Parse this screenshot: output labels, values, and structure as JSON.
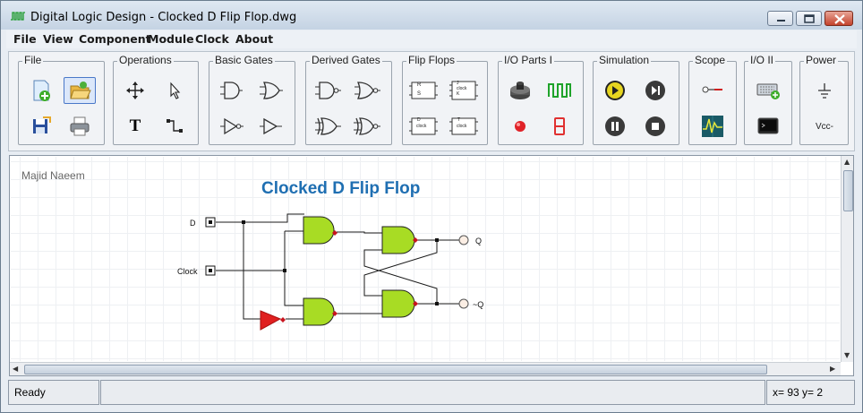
{
  "window": {
    "title": "Digital Logic Design - Clocked D Flip Flop.dwg"
  },
  "menu": [
    "File",
    "View",
    "Component",
    "Module",
    "Clock",
    "About"
  ],
  "toolbar": {
    "groups": [
      {
        "label": "File"
      },
      {
        "label": "Operations"
      },
      {
        "label": "Basic Gates"
      },
      {
        "label": "Derived Gates"
      },
      {
        "label": "Flip Flops"
      },
      {
        "label": "I/O Parts I"
      },
      {
        "label": "Simulation"
      },
      {
        "label": "Scope"
      },
      {
        "label": "I/O II"
      },
      {
        "label": "Power"
      }
    ],
    "operations_text_tool": "T",
    "flipflop_labels": {
      "sr": [
        "R",
        "S"
      ],
      "jk": [
        "J",
        "clock",
        "K"
      ],
      "d": [
        "D",
        "clock"
      ],
      "t": [
        "T",
        "clock"
      ]
    },
    "power_vcc_label": "Vcc-"
  },
  "canvas": {
    "author": "Majid Naeem",
    "title": "Clocked D Flip Flop",
    "input_d_label": "D",
    "input_clock_label": "Clock",
    "output_q_label": "Q",
    "output_nq_label": "~Q"
  },
  "status": {
    "text": "Ready",
    "middle": "",
    "coords": "x= 93  y= 2"
  },
  "colors": {
    "gate_fill": "#a8dc24",
    "title_color": "#1f6fb2",
    "not_gate_fill": "#e02020",
    "pin_color": "#c8141e"
  }
}
